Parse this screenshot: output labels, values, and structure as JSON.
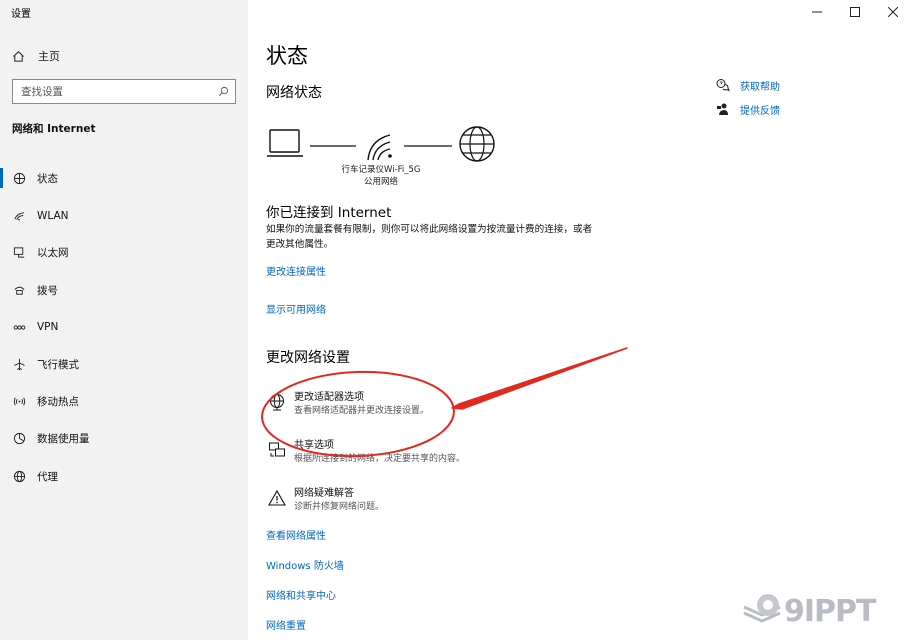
{
  "window": {
    "title": "设置"
  },
  "sidebar": {
    "home_label": "主页",
    "search_placeholder": "查找设置",
    "section_label": "网络和 Internet",
    "items": [
      {
        "label": "状态",
        "icon": "status-icon",
        "active": true
      },
      {
        "label": "WLAN",
        "icon": "wifi-icon"
      },
      {
        "label": "以太网",
        "icon": "ethernet-icon"
      },
      {
        "label": "拨号",
        "icon": "dialup-icon"
      },
      {
        "label": "VPN",
        "icon": "vpn-icon"
      },
      {
        "label": "飞行模式",
        "icon": "airplane-icon"
      },
      {
        "label": "移动热点",
        "icon": "hotspot-icon"
      },
      {
        "label": "数据使用量",
        "icon": "data-usage-icon"
      },
      {
        "label": "代理",
        "icon": "proxy-icon"
      }
    ]
  },
  "main": {
    "title": "状态",
    "network_status_heading": "网络状态",
    "network": {
      "name": "行车记录仪Wi-Fi_5G",
      "type": "公用网络"
    },
    "status_heading": "你已连接到 Internet",
    "status_desc": "如果你的流量套餐有限制，则你可以将此网络设置为按流量计费的连接，或者更改其他属性。",
    "link_change_connection": "更改连接属性",
    "link_show_networks": "显示可用网络",
    "change_settings_heading": "更改网络设置",
    "options": [
      {
        "title": "更改适配器选项",
        "desc": "查看网络适配器并更改连接设置。",
        "icon": "adapter-icon"
      },
      {
        "title": "共享选项",
        "desc": "根据所连接到的网络，决定要共享的内容。",
        "icon": "sharing-icon"
      },
      {
        "title": "网络疑难解答",
        "desc": "诊断并修复网络问题。",
        "icon": "warning-icon"
      }
    ],
    "links": [
      "查看网络属性",
      "Windows 防火墙",
      "网络和共享中心",
      "网络重置"
    ]
  },
  "help": {
    "get_help": "获取帮助",
    "feedback": "提供反馈"
  },
  "watermark": {
    "text": "9IPPT"
  },
  "colors": {
    "accent": "#0067c0",
    "annotation": "#e02a20",
    "sidebar_bg": "#f2f2f2"
  }
}
